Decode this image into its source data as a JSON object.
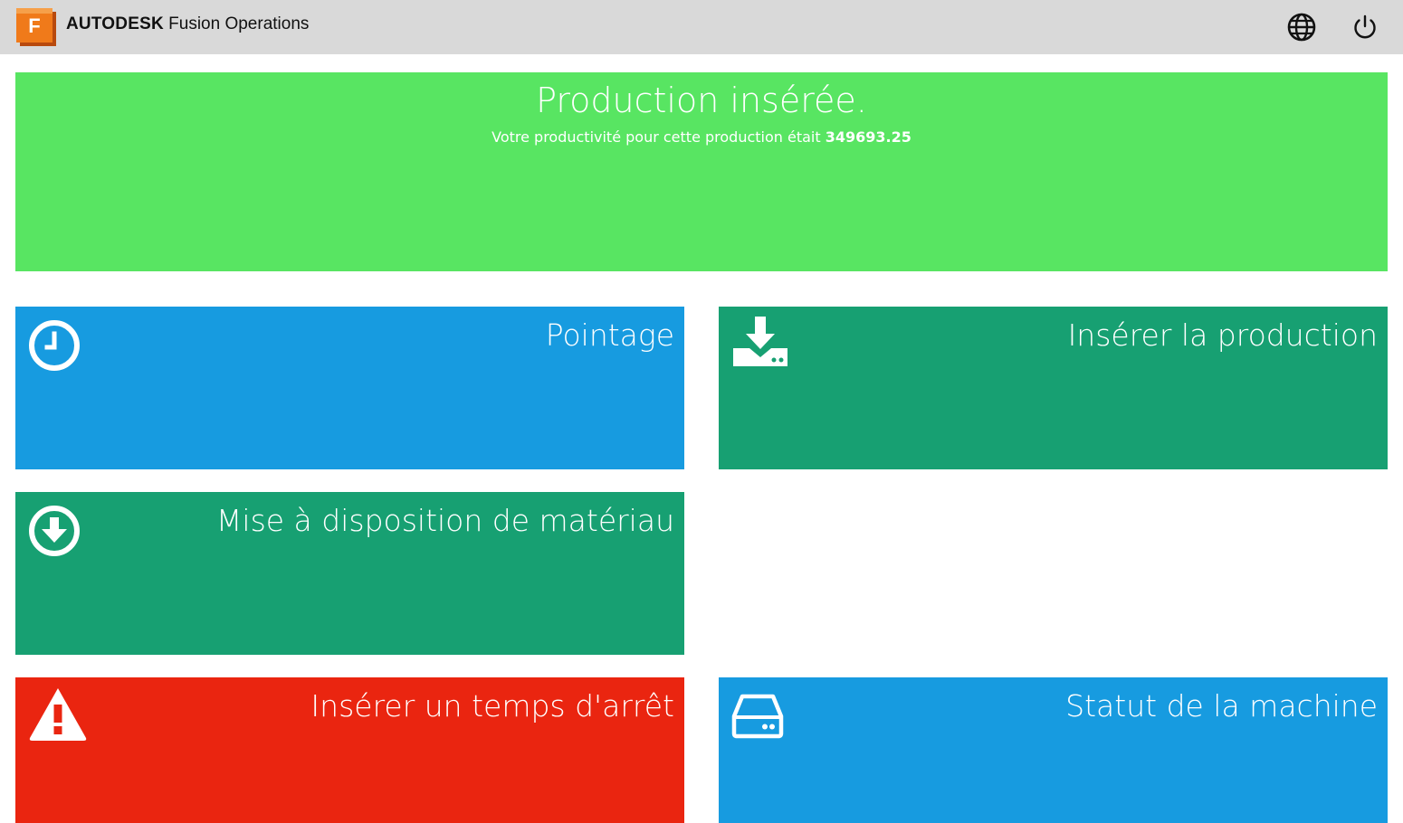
{
  "header": {
    "brand_bold": "AUTODESK",
    "brand_product": "Fusion Operations",
    "logo_letter": "F",
    "icons": {
      "language": "globe-icon",
      "logout": "power-icon"
    }
  },
  "banner": {
    "title": "Production insérée.",
    "message": "Votre productivité pour cette production était",
    "value": "349693.25",
    "color": "#58e562"
  },
  "tiles": [
    {
      "label": "Pointage",
      "icon": "clock-icon",
      "color": "#179be0"
    },
    {
      "label": "Insérer la production",
      "icon": "download-tray-icon",
      "color": "#17a072"
    },
    {
      "label": "Mise à disposition de matériau",
      "icon": "arrow-down-circle-icon",
      "color": "#17a072"
    },
    {
      "label": "Insérer un temps d'arrêt",
      "icon": "warning-icon",
      "color": "#ea2510"
    },
    {
      "label": "Statut de la machine",
      "icon": "hard-drive-icon",
      "color": "#179be0"
    }
  ]
}
